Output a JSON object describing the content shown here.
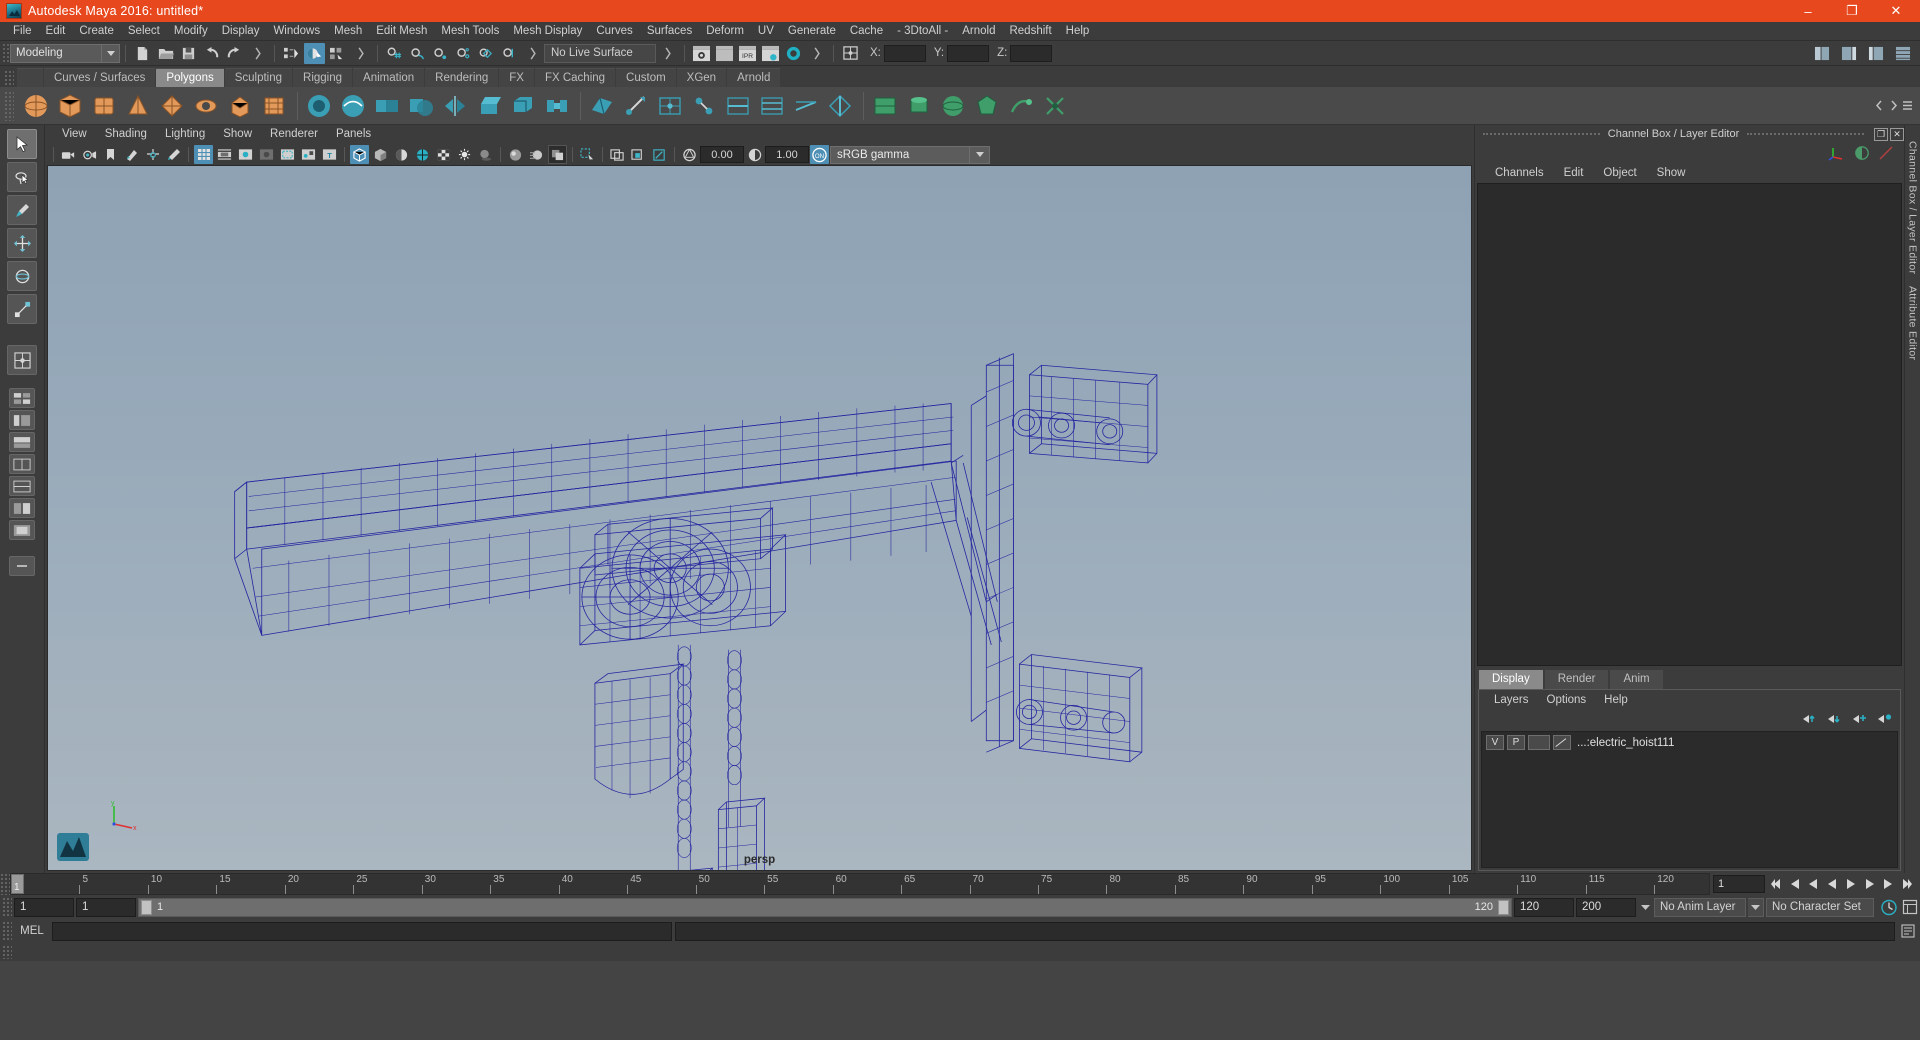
{
  "window": {
    "title": "Autodesk Maya 2016: untitled*",
    "logo_icon": "maya-logo-icon",
    "minimize_label": "–",
    "maximize_label": "❐",
    "close_label": "✕",
    "accent_color": "#e8481e"
  },
  "menubar": {
    "items": [
      "File",
      "Edit",
      "Create",
      "Select",
      "Modify",
      "Display",
      "Windows",
      "Mesh",
      "Edit Mesh",
      "Mesh Tools",
      "Mesh Display",
      "Curves",
      "Surfaces",
      "Deform",
      "UV",
      "Generate",
      "Cache",
      "- 3DtoAll -",
      "Arnold",
      "Redshift",
      "Help"
    ]
  },
  "statusbar": {
    "menu_set": "Modeling",
    "live_surface": "No Live Surface",
    "axis_x_label": "X:",
    "axis_y_label": "Y:",
    "axis_z_label": "Z:",
    "axis_x_value": "",
    "axis_y_value": "",
    "axis_z_value": "",
    "icons": [
      "new-scene-icon",
      "open-scene-icon",
      "save-scene-icon",
      "undo-icon",
      "redo-icon",
      "select-by-hierarchy-icon",
      "select-by-object-icon",
      "select-by-component-icon",
      "snap-grid-icon",
      "snap-curve-icon",
      "snap-point-icon",
      "snap-projected-icon",
      "snap-view-plane-icon",
      "make-live-icon",
      "render-view-icon",
      "render-current-frame-icon",
      "ipr-render-icon",
      "render-settings-icon",
      "hypershade-icon",
      "toggle-editors-icon"
    ]
  },
  "shelf": {
    "tabs": [
      "Curves / Surfaces",
      "Polygons",
      "Sculpting",
      "Rigging",
      "Animation",
      "Rendering",
      "FX",
      "FX Caching",
      "Custom",
      "XGen",
      "Arnold"
    ],
    "active_tab": "Polygons",
    "icons": [
      "poly-sphere-icon",
      "poly-cube-icon",
      "poly-cylinder-icon",
      "poly-cone-icon",
      "poly-torus-icon",
      "poly-plane-icon",
      "poly-prism-icon",
      "poly-pyramid-icon",
      "sculpt-sphere-icon",
      "smooth-icon",
      "combine-icon",
      "booleans-icon",
      "mirror-icon",
      "extrude-icon",
      "bevel-icon",
      "bridge-icon",
      "append-polygon-icon",
      "multi-cut-icon",
      "quad-draw-icon",
      "target-weld-icon",
      "insert-edge-loop-icon",
      "offset-edge-loop-icon",
      "slide-edge-icon",
      "crease-icon",
      "uv-planar-icon",
      "uv-cylindrical-icon",
      "uv-spherical-icon",
      "uv-automatic-icon",
      "uv-unfold-icon",
      "uv-layout-icon"
    ],
    "scroll_left_icon": "chevron-left-icon",
    "scroll_right_icon": "chevron-right-icon",
    "menu_icon": "shelf-menu-icon"
  },
  "toolbox": {
    "tools": [
      "select-tool",
      "lasso-select-tool",
      "paint-select-tool",
      "move-tool",
      "rotate-tool",
      "scale-tool",
      "last-tool-used",
      "show-manipulator-tool"
    ],
    "layouts": [
      "single-perspective-layout",
      "four-view-layout",
      "persp-outliner-layout",
      "persp-graph-layout",
      "two-pane-stacked-layout",
      "two-pane-side-layout",
      "hypershade-layout",
      "outliner-persp-layout",
      "expand-layouts-icon"
    ]
  },
  "viewport": {
    "menu": [
      "View",
      "Shading",
      "Lighting",
      "Show",
      "Renderer",
      "Panels"
    ],
    "camera_label": "persp",
    "exposure_value": "0.00",
    "gamma_value": "1.00",
    "color_space": "sRGB gamma",
    "color_management_toggle": "ON",
    "toolbar_icons": [
      "select-camera-icon",
      "camera-attributes-icon",
      "bookmark-icon",
      "image-plane-icon",
      "two-d-pan-zoom-icon",
      "grease-pencil-icon",
      "grid-toggle-icon",
      "film-gate-icon",
      "resolution-gate-icon",
      "gate-mask-icon",
      "film-origin-icon",
      "safe-action-icon",
      "title-safe-icon",
      "wireframe-icon",
      "smooth-shade-icon",
      "shade-flat-icon",
      "wireframe-on-shaded-icon",
      "texture-toggle-icon",
      "use-default-lighting-icon",
      "shadows-icon",
      "screen-space-ao-icon",
      "motion-blur-icon",
      "multisample-icon",
      "isolate-select-icon",
      "xray-icon",
      "xray-joints-icon",
      "xray-active-components-icon",
      "exposure-icon",
      "gamma-icon"
    ]
  },
  "channel_box": {
    "title": "Channel Box / Layer Editor",
    "float_button": "❐",
    "close_button": "✕",
    "header_icons": [
      "move-axis-icon",
      "shading-toggle-icon",
      "attribute-curve-icon"
    ],
    "menu": [
      "Channels",
      "Edit",
      "Object",
      "Show"
    ]
  },
  "layer_editor": {
    "tabs": [
      "Display",
      "Render",
      "Anim"
    ],
    "active_tab": "Display",
    "menu": [
      "Layers",
      "Options",
      "Help"
    ],
    "buttons": [
      "move-layer-up-icon",
      "move-layer-down-icon",
      "new-layer-icon",
      "new-layer-from-selected-icon"
    ],
    "layers": [
      {
        "visibility": "V",
        "playback": "P",
        "shading": "",
        "name": "...:electric_hoist111"
      }
    ]
  },
  "side_tabs": [
    "Channel Box / Layer Editor",
    "Attribute Editor"
  ],
  "timeline": {
    "ticks": [
      5,
      10,
      15,
      20,
      25,
      30,
      35,
      40,
      45,
      50,
      55,
      60,
      65,
      70,
      75,
      80,
      85,
      90,
      95,
      100,
      105,
      110,
      115,
      120
    ],
    "current_frame": "1",
    "current_frame_field": "1",
    "playhead_label": "1",
    "range_start": "1",
    "range_start_2": "1",
    "slider_min": "1",
    "slider_max": "120",
    "end_field": "120",
    "end_field_2": "200",
    "anim_layer": "No Anim Layer",
    "character_set": "No Character Set",
    "playback_icons": [
      "go-to-start-icon",
      "step-back-keyframe-icon",
      "step-back-frame-icon",
      "play-backwards-icon",
      "play-forwards-icon",
      "step-forward-frame-icon",
      "step-forward-keyframe-icon",
      "go-to-end-icon"
    ],
    "auto_key_icon": "auto-keyframe-icon",
    "anim_prefs_icon": "animation-preferences-icon"
  },
  "command_line": {
    "language_label": "MEL",
    "input_value": "",
    "output_value": "",
    "script_editor_icon": "script-editor-icon"
  },
  "scene": {
    "object_name": "electric_hoist111",
    "wireframe_color": "#1f1f9e",
    "background_top": "#8ea2b4",
    "background_bottom": "#aab6c0"
  }
}
